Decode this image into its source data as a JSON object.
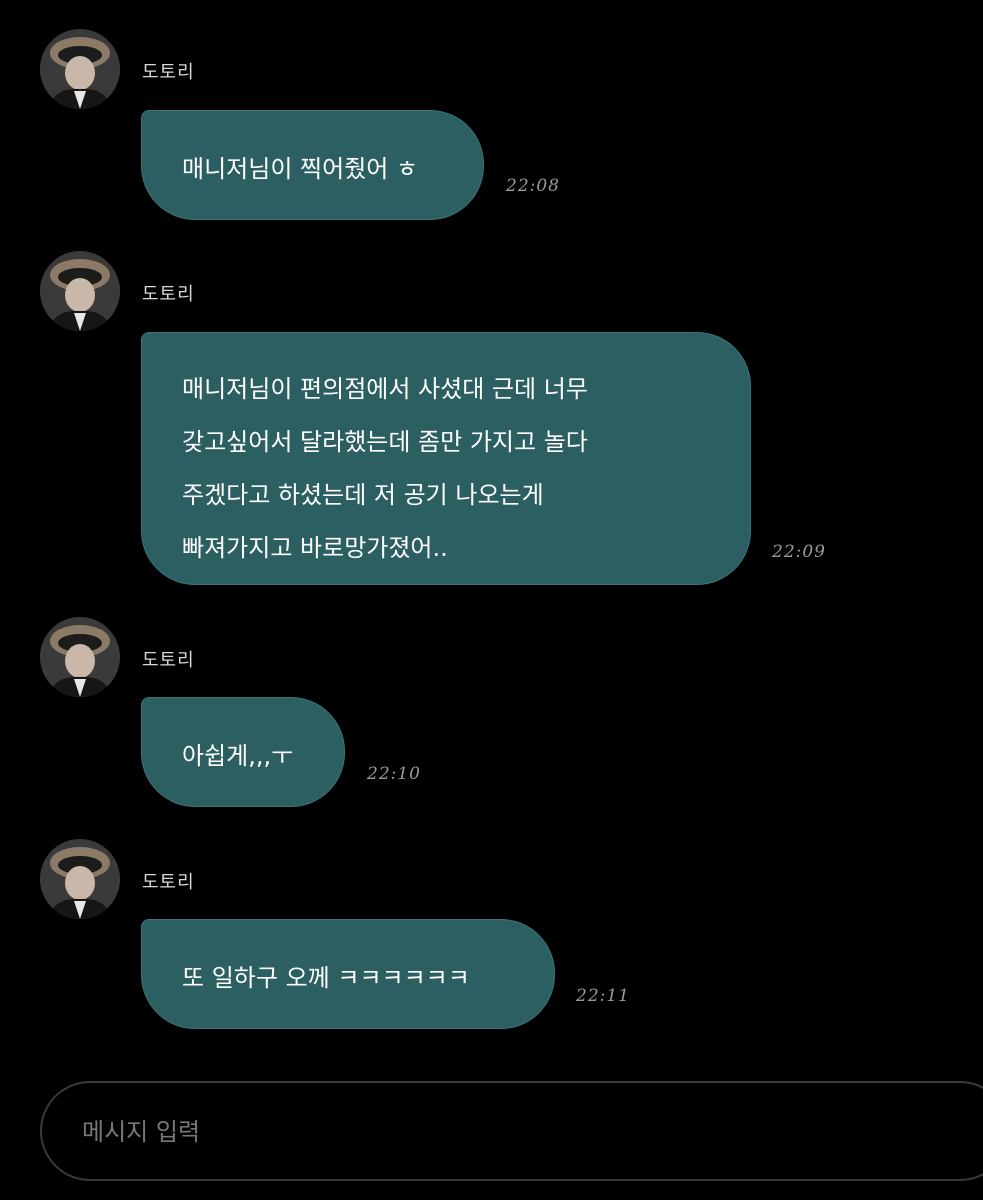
{
  "colors": {
    "background": "#000000",
    "bubble": "#2b5f62",
    "timestamp": "#9a9a9a",
    "input_border": "#3a3a3a"
  },
  "messages": [
    {
      "sender": "도토리",
      "avatar": "profile-photo",
      "lines": [
        "매니저님이 찍어줬어 ㅎ"
      ],
      "time": "22:08"
    },
    {
      "sender": "도토리",
      "avatar": "profile-photo",
      "lines": [
        "매니저님이 편의점에서 사셨대 근데 너무",
        "갖고싶어서 달라했는데 좀만 가지고 놀다",
        "주겠다고 하셨는데 저 공기 나오는게",
        "빠져가지고 바로망가졌어.."
      ],
      "time": "22:09"
    },
    {
      "sender": "도토리",
      "avatar": "profile-photo",
      "lines": [
        "아쉽게,,,ㅜ"
      ],
      "time": "22:10"
    },
    {
      "sender": "도토리",
      "avatar": "profile-photo",
      "lines": [
        "또 일하구 오께 ㅋㅋㅋㅋㅋㅋ"
      ],
      "time": "22:11"
    }
  ],
  "composer": {
    "placeholder": "메시지 입력"
  }
}
